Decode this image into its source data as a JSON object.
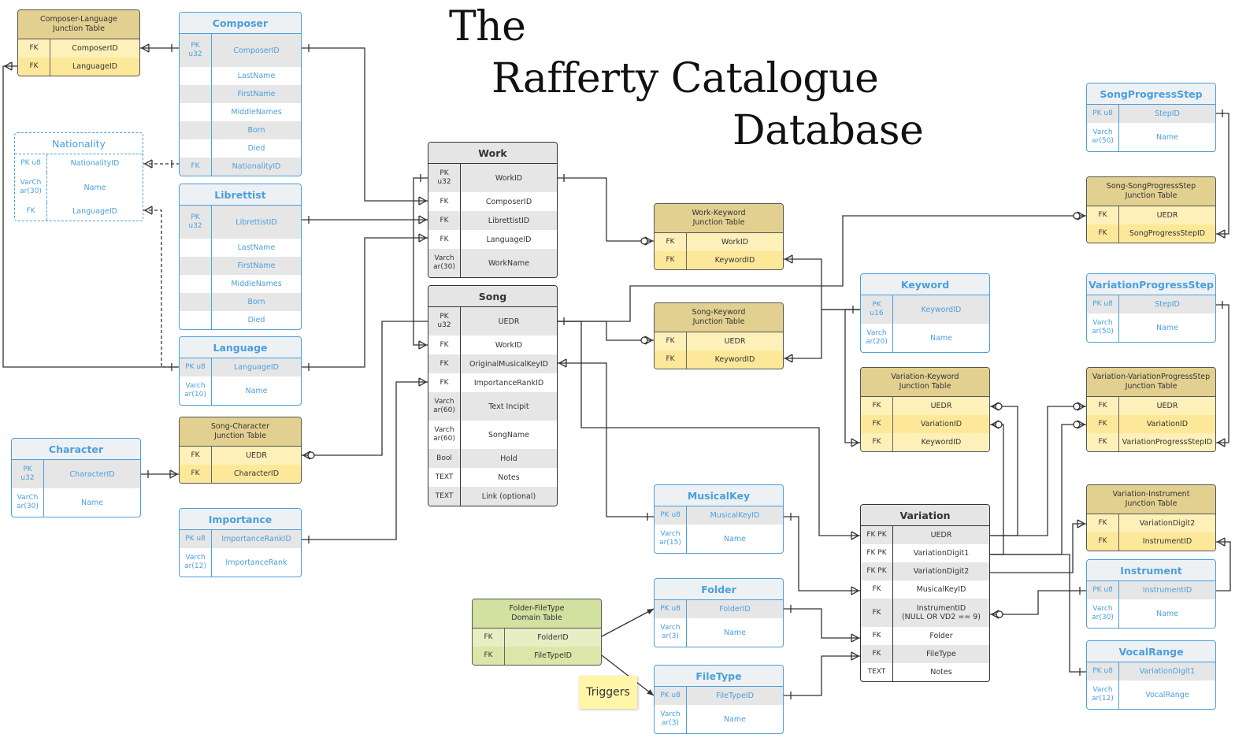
{
  "diagram": {
    "title_lines": [
      "The",
      "Rafferty Catalogue",
      "Database"
    ],
    "note": "Triggers",
    "tables": {
      "composer_language": {
        "title": "Composer-Language\nJunction Table",
        "rows": [
          {
            "key": "FK",
            "field": "ComposerID"
          },
          {
            "key": "FK",
            "field": "LanguageID"
          }
        ]
      },
      "composer": {
        "title": "Composer",
        "rows": [
          {
            "key": "PK\nu32",
            "field": "ComposerID"
          },
          {
            "key": "",
            "field": "LastName"
          },
          {
            "key": "",
            "field": "FirstName"
          },
          {
            "key": "",
            "field": "MiddleNames"
          },
          {
            "key": "",
            "field": "Born"
          },
          {
            "key": "",
            "field": "Died"
          },
          {
            "key": "FK",
            "field": "NationalityID"
          }
        ]
      },
      "nationality": {
        "title": "Nationality",
        "rows": [
          {
            "key": "PK u8",
            "field": "NationalityID"
          },
          {
            "key": "VarCh\nar(30)",
            "field": "Name"
          },
          {
            "key": "FK",
            "field": "LanguageID"
          }
        ]
      },
      "librettist": {
        "title": "Librettist",
        "rows": [
          {
            "key": "PK\nu32",
            "field": "LibrettistID"
          },
          {
            "key": "",
            "field": "LastName"
          },
          {
            "key": "",
            "field": "FirstName"
          },
          {
            "key": "",
            "field": "MiddleNames"
          },
          {
            "key": "",
            "field": "Born"
          },
          {
            "key": "",
            "field": "Died"
          }
        ]
      },
      "language": {
        "title": "Language",
        "rows": [
          {
            "key": "PK u8",
            "field": "LanguageID"
          },
          {
            "key": "Varch\nar(10)",
            "field": "Name"
          }
        ]
      },
      "character": {
        "title": "Character",
        "rows": [
          {
            "key": "PK\nu32",
            "field": "CharacterID"
          },
          {
            "key": "VarCh\nar(30)",
            "field": "Name"
          }
        ]
      },
      "song_character": {
        "title": "Song-Character\nJunction Table",
        "rows": [
          {
            "key": "FK",
            "field": "UEDR"
          },
          {
            "key": "FK",
            "field": "CharacterID"
          }
        ]
      },
      "importance": {
        "title": "Importance",
        "rows": [
          {
            "key": "PK u8",
            "field": "ImportanceRankID"
          },
          {
            "key": "Varch\nar(12)",
            "field": "ImportanceRank"
          }
        ]
      },
      "work": {
        "title": "Work",
        "rows": [
          {
            "key": "PK\nu32",
            "field": "WorkID"
          },
          {
            "key": "FK",
            "field": "ComposerID"
          },
          {
            "key": "FK",
            "field": "LibrettistID"
          },
          {
            "key": "FK",
            "field": "LanguageID"
          },
          {
            "key": "Varch\nar(30)",
            "field": "WorkName"
          }
        ]
      },
      "song": {
        "title": "Song",
        "rows": [
          {
            "key": "PK\nu32",
            "field": "UEDR"
          },
          {
            "key": "FK",
            "field": "WorkID"
          },
          {
            "key": "FK",
            "field": "OriginalMusicalKeyID"
          },
          {
            "key": "FK",
            "field": "ImportanceRankID"
          },
          {
            "key": "Varch\nar(60)",
            "field": "Text Incipit"
          },
          {
            "key": "Varch\nar(60)",
            "field": "SongName"
          },
          {
            "key": "Bool",
            "field": "Hold"
          },
          {
            "key": "TEXT",
            "field": "Notes"
          },
          {
            "key": "TEXT",
            "field": "Link (optional)"
          }
        ]
      },
      "work_keyword": {
        "title": "Work-Keyword\nJunction Table",
        "rows": [
          {
            "key": "FK",
            "field": "WorkID"
          },
          {
            "key": "FK",
            "field": "KeywordID"
          }
        ]
      },
      "song_keyword": {
        "title": "Song-Keyword\nJunction Table",
        "rows": [
          {
            "key": "FK",
            "field": "UEDR"
          },
          {
            "key": "FK",
            "field": "KeywordID"
          }
        ]
      },
      "musicalkey": {
        "title": "MusicalKey",
        "rows": [
          {
            "key": "PK u8",
            "field": "MusicalKeyID"
          },
          {
            "key": "Varch\nar(15)",
            "field": "Name"
          }
        ]
      },
      "folder_filetype": {
        "title": "Folder-FileType\nDomain Table",
        "rows": [
          {
            "key": "FK",
            "field": "FolderID"
          },
          {
            "key": "FK",
            "field": "FileTypeID"
          }
        ]
      },
      "folder": {
        "title": "Folder",
        "rows": [
          {
            "key": "PK u8",
            "field": "FolderID"
          },
          {
            "key": "Varch\nar(3)",
            "field": "Name"
          }
        ]
      },
      "filetype": {
        "title": "FileType",
        "rows": [
          {
            "key": "PK u8",
            "field": "FileTypeID"
          },
          {
            "key": "Varch\nar(3)",
            "field": "Name"
          }
        ]
      },
      "keyword": {
        "title": "Keyword",
        "rows": [
          {
            "key": "PK\nu16",
            "field": "KeywordID"
          },
          {
            "key": "Varch\nar(20)",
            "field": "Name"
          }
        ]
      },
      "variation_keyword": {
        "title": "Variation-Keyword\nJunction Table",
        "rows": [
          {
            "key": "FK",
            "field": "UEDR"
          },
          {
            "key": "FK",
            "field": "VariationID"
          },
          {
            "key": "FK",
            "field": "KeywordID"
          }
        ]
      },
      "variation": {
        "title": "Variation",
        "rows": [
          {
            "key": "FK PK",
            "field": "UEDR"
          },
          {
            "key": "FK PK",
            "field": "VariationDigit1"
          },
          {
            "key": "FK PK",
            "field": "VariationDigit2"
          },
          {
            "key": "FK",
            "field": "MusicalKeyID"
          },
          {
            "key": "FK",
            "field": "InstrumentID\n(NULL OR VD2 == 9)"
          },
          {
            "key": "FK",
            "field": "Folder"
          },
          {
            "key": "FK",
            "field": "FileType"
          },
          {
            "key": "TEXT",
            "field": "Notes"
          }
        ]
      },
      "songprogressstep": {
        "title": "SongProgressStep",
        "rows": [
          {
            "key": "PK u8",
            "field": "StepID"
          },
          {
            "key": "Varch\nar(50)",
            "field": "Name"
          }
        ]
      },
      "song_songprogressstep": {
        "title": "Song-SongProgressStep\nJunction Table",
        "rows": [
          {
            "key": "FK",
            "field": "UEDR"
          },
          {
            "key": "FK",
            "field": "SongProgressStepID"
          }
        ]
      },
      "variationprogressstep": {
        "title": "VariationProgressStep",
        "rows": [
          {
            "key": "PK u8",
            "field": "StepID"
          },
          {
            "key": "Varch\nar(50)",
            "field": "Name"
          }
        ]
      },
      "variation_variationprogressstep": {
        "title": "Variation-VariationProgressStep\nJunction Table",
        "rows": [
          {
            "key": "FK",
            "field": "UEDR"
          },
          {
            "key": "FK",
            "field": "VariationID"
          },
          {
            "key": "FK",
            "field": "VariationProgressStepID"
          }
        ]
      },
      "variation_instrument": {
        "title": "Variation-Instrument\nJunction Table",
        "rows": [
          {
            "key": "FK",
            "field": "VariationDigit2"
          },
          {
            "key": "FK",
            "field": "InstrumentID"
          }
        ]
      },
      "instrument": {
        "title": "Instrument",
        "rows": [
          {
            "key": "PK u8",
            "field": "InstrumentID"
          },
          {
            "key": "Varch\nar(30)",
            "field": "Name"
          }
        ]
      },
      "vocalrange": {
        "title": "VocalRange",
        "rows": [
          {
            "key": "PK u8",
            "field": "VariationDigit1"
          },
          {
            "key": "Varch\nar(12)",
            "field": "VocalRange"
          }
        ]
      }
    }
  }
}
